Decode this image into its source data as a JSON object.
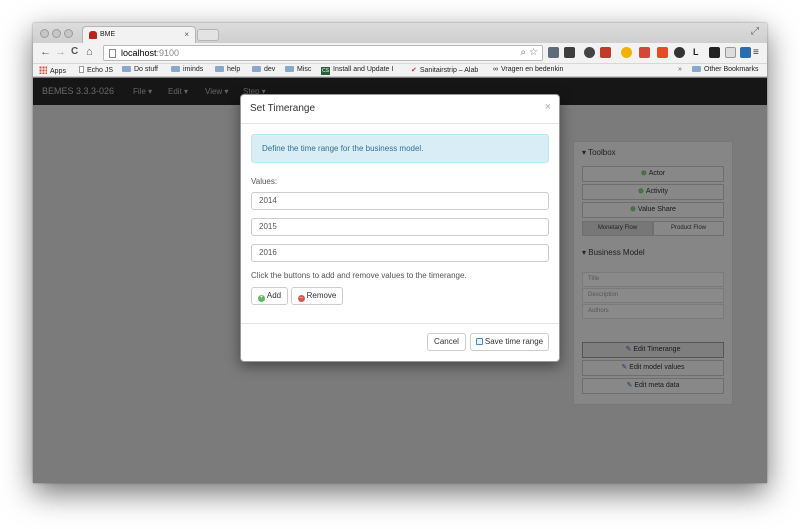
{
  "browser": {
    "tab_title": "BME",
    "tab_close": "×",
    "url_host": "localhost",
    "url_port": ":9100",
    "nav": {
      "back": "←",
      "forward": "→",
      "reload": "C",
      "home": "⌂"
    },
    "bookmarks": [
      {
        "label": "Apps",
        "kind": "apps"
      },
      {
        "label": "Echo JS",
        "kind": "page"
      },
      {
        "label": "Do stuff",
        "kind": "folder"
      },
      {
        "label": "iminds",
        "kind": "folder"
      },
      {
        "label": "help",
        "kind": "folder"
      },
      {
        "label": "dev",
        "kind": "folder"
      },
      {
        "label": "Misc",
        "kind": "folder"
      },
      {
        "label": "Install and Update I",
        "kind": "badge"
      },
      {
        "label": "Sanitairstrip – Alab",
        "kind": "check"
      },
      {
        "label": "Vragen en bedenkin",
        "kind": "loop"
      }
    ],
    "more_bookmarks": "»",
    "other_bookmarks": "Other Bookmarks"
  },
  "app": {
    "brand": "BEMES 3.3.3-026",
    "menu": [
      "File ▾",
      "Edit ▾",
      "View ▾",
      "Step ▾"
    ]
  },
  "toolbox": {
    "title": "▾ Toolbox",
    "buttons": [
      "Actor",
      "Activity",
      "Value Share"
    ],
    "flows": [
      "Monetary Flow",
      "Product Flow"
    ]
  },
  "business_model": {
    "title": "▾ Business Model",
    "fields": [
      "Title",
      "Description",
      "Authors"
    ],
    "actions": [
      "Edit Timerange",
      "Edit model values",
      "Edit meta data"
    ]
  },
  "modal": {
    "title": "Set Timerange",
    "close": "×",
    "info": "Define the time range for the business model.",
    "values_label": "Values:",
    "values": [
      "2014",
      "2015",
      "2016"
    ],
    "hint": "Click the buttons to add and remove values to the timerange.",
    "add_label": "Add",
    "remove_label": "Remove",
    "cancel_label": "Cancel",
    "save_label": "Save time range"
  },
  "colors": {
    "info_bg": "#d9edf7",
    "info_text": "#31708f",
    "add_green": "#5cb85c",
    "remove_red": "#d9534f",
    "navbar": "#161616"
  }
}
